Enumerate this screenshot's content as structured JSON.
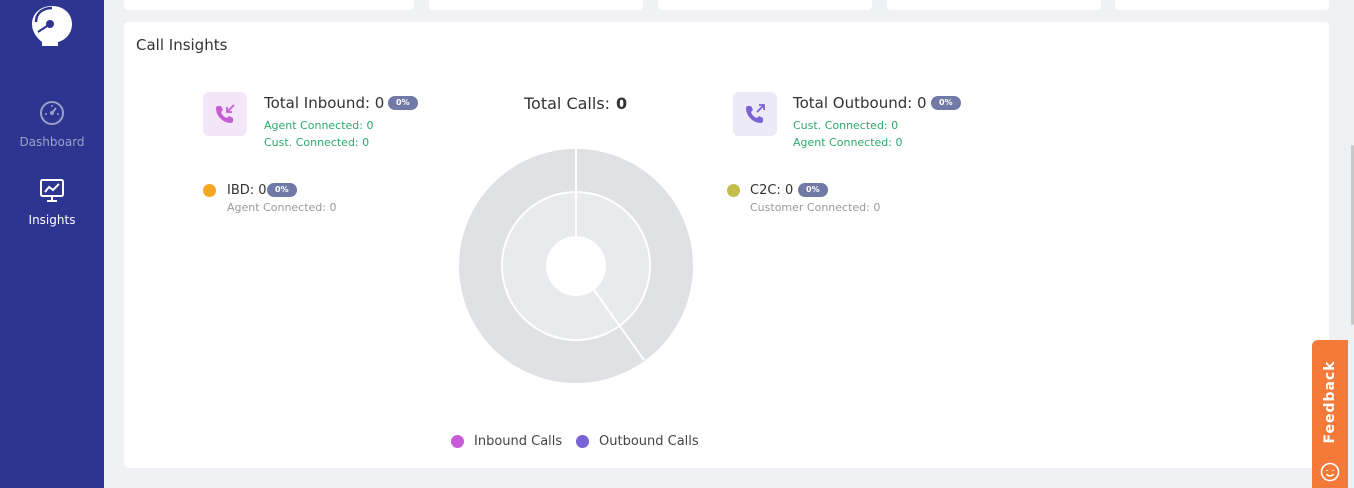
{
  "sidebar": {
    "items": [
      {
        "label": "Dashboard",
        "icon": "speedometer-icon"
      },
      {
        "label": "Insights",
        "icon": "monitor-chart-icon",
        "active": true
      }
    ]
  },
  "card": {
    "title": "Call Insights"
  },
  "inbound": {
    "title": "Total Inbound: 0",
    "badge": "0%",
    "agent_connected": "Agent Connected: 0",
    "cust_connected": "Cust. Connected: 0",
    "ibd": {
      "label": "IBD: 0",
      "badge": "0%",
      "sub": "Agent Connected: 0",
      "color": "#f5a623"
    }
  },
  "outbound": {
    "title": "Total Outbound: 0",
    "badge": "0%",
    "cust_connected": "Cust. Connected: 0",
    "agent_connected": "Agent Connected: 0",
    "c2c": {
      "label": "C2C: 0",
      "badge": "0%",
      "sub": "Customer Connected: 0",
      "color": "#c4be4e"
    }
  },
  "total_calls": {
    "label": "Total Calls:",
    "value": "0"
  },
  "legend": {
    "inbound": {
      "label": "Inbound Calls",
      "color": "#c85bd6"
    },
    "outbound": {
      "label": "Outbound Calls",
      "color": "#7a63d4"
    }
  },
  "feedback": {
    "label": "Feedback"
  },
  "colors": {
    "sidebar": "#2d3591",
    "feedback": "#f47a3a",
    "badge": "#717aa6",
    "green": "#2fa86d"
  }
}
